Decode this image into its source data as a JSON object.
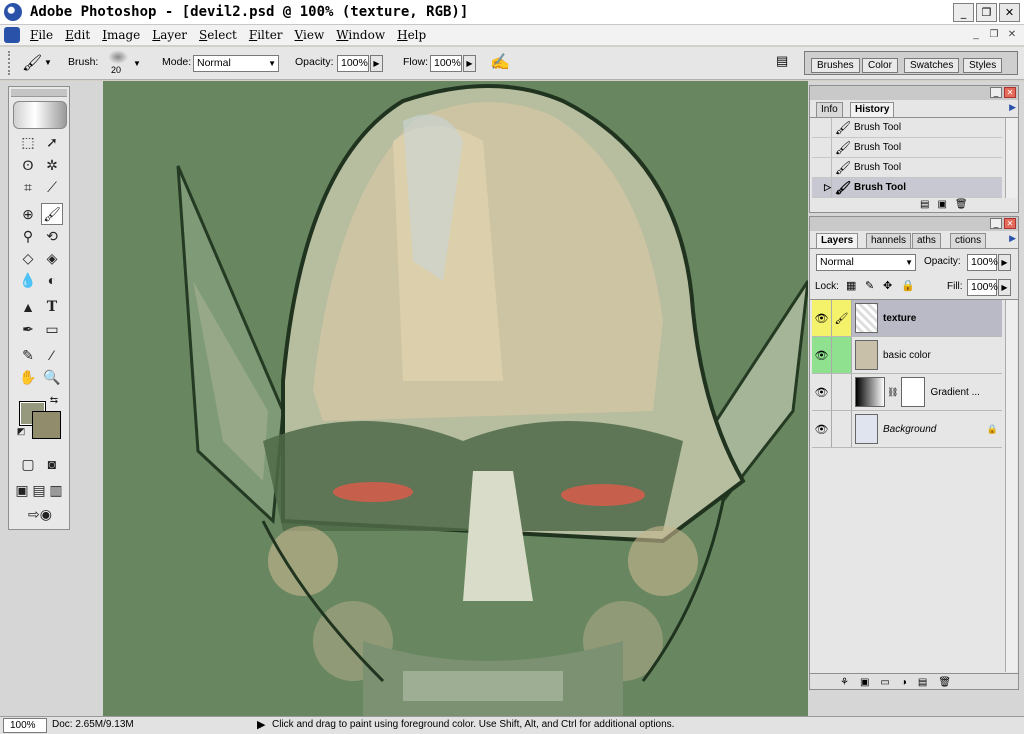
{
  "window": {
    "title": "Adobe Photoshop - [devil2.psd @ 100% (texture, RGB)]",
    "min": "_",
    "max": "❐",
    "close": "✕"
  },
  "menu": [
    "File",
    "Edit",
    "Image",
    "Layer",
    "Select",
    "Filter",
    "View",
    "Window",
    "Help"
  ],
  "options": {
    "brush_label": "Brush:",
    "brush_size": "20",
    "mode_label": "Mode:",
    "mode_value": "Normal",
    "opacity_label": "Opacity:",
    "opacity_value": "100%",
    "flow_label": "Flow:",
    "flow_value": "100%"
  },
  "palette_well": [
    "Brushes",
    "Color",
    "Swatches",
    "Styles"
  ],
  "colors": {
    "foreground": "#97997f",
    "background": "#918c6b",
    "canvas_bg": "#6b8a63"
  },
  "history_panel": {
    "tabs": [
      "Info",
      "History"
    ],
    "items": [
      "Brush Tool",
      "Brush Tool",
      "Brush Tool",
      "Brush Tool"
    ],
    "current_index": 3
  },
  "layers_panel": {
    "tabs": [
      "Layers",
      "Channels",
      "Paths",
      "Actions"
    ],
    "tab_display": [
      "Layers",
      "hannels",
      "aths",
      "ctions"
    ],
    "blend_mode": "Normal",
    "opacity_label": "Opacity:",
    "opacity_value": "100%",
    "lock_label": "Lock:",
    "fill_label": "Fill:",
    "fill_value": "100%",
    "layers": [
      {
        "name": "texture",
        "selected": true
      },
      {
        "name": "basic color",
        "selected": false
      },
      {
        "name": "Gradient ...",
        "selected": false
      },
      {
        "name": "Background",
        "selected": false
      }
    ]
  },
  "status": {
    "zoom": "100%",
    "doc": "Doc: 2.65M/9.13M",
    "hint": "Click and drag to paint using foreground color.  Use Shift, Alt, and Ctrl for additional options."
  }
}
